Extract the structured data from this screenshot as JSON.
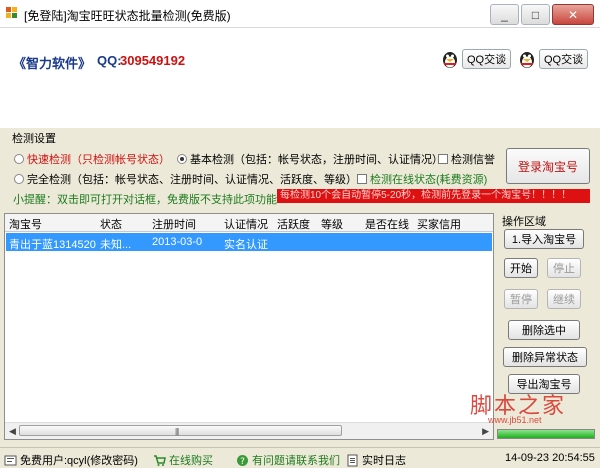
{
  "window": {
    "title": "[免登陆]淘宝旺旺状态批量检测(免费版)",
    "controls": [
      "_",
      "□",
      "✕"
    ]
  },
  "header": {
    "brand": "《智力软件》",
    "qq_label": "QQ:",
    "qq_number": "309549192",
    "qq_button_1": "QQ交谈",
    "qq_button_2": "QQ交谈"
  },
  "settings": {
    "group_title": "检测设置",
    "quick_check": "快速检测（只检测帐号状态）",
    "basic_check": "基本检测（包括：帐号状态，注册时间、认证情况）",
    "full_check": "完全检测（包括：帐号状态、注册时间、认证情况、活跃度、等级）",
    "check_credit": "检测信誉",
    "check_online": "检测在线状态(耗费资源)",
    "selected_mode": "basic_check",
    "login_button": "登录淘宝号"
  },
  "tip": "小提醒：双击即可打开对话框，免费版不支持此项功能",
  "notice": "每检测10个会自动暂停5-20秒，检测前先登录一个淘宝号！！！！",
  "grid": {
    "columns": [
      "淘宝号",
      "状态",
      "注册时间",
      "认证情况",
      "活跃度",
      "等级",
      "是否在线",
      "买家信用"
    ],
    "rows": [
      [
        "青出于蓝1314520",
        "未知...",
        "2013-03-0",
        "实名认证",
        "",
        "",
        "",
        ""
      ]
    ]
  },
  "operations": {
    "title": "操作区域",
    "import": "1.导入淘宝号",
    "start": "开始",
    "stop": "停止",
    "pause": "暂停",
    "resume": "继续",
    "delete_selected": "删除选中",
    "delete_abnormal": "删除异常状态",
    "export": "导出淘宝号",
    "progress_fraction": 1.0
  },
  "statusbar": {
    "user": "免费用户:qcyl(修改密码)",
    "buy_online": "在线购买",
    "contact": "有问题请联系我们",
    "realtime_log": "实时日志",
    "datetime": "14-09-23 20:54:55"
  },
  "watermark": {
    "text": "脚本之家",
    "url": "www.jb51.net"
  },
  "colors": {
    "accent_red": "#d01010",
    "selection_blue": "#3399ff",
    "green_text": "#1e7b1e",
    "window_bg": "#ece9d8"
  }
}
